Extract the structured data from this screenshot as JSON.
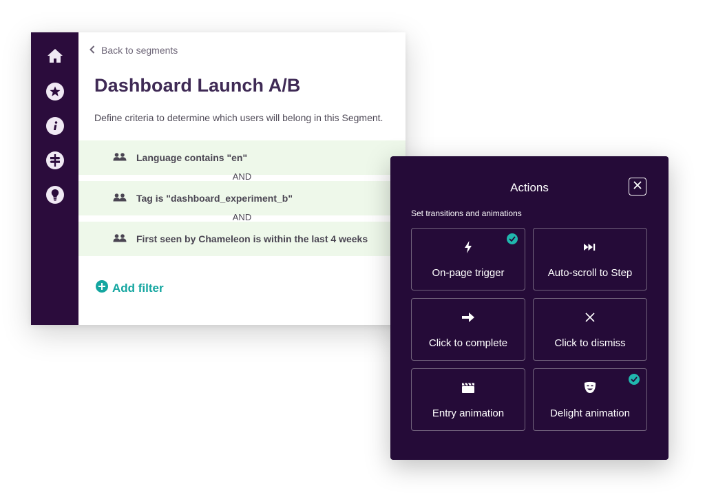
{
  "segment": {
    "back_label": "Back to segments",
    "title": "Dashboard Launch A/B",
    "description": "Define criteria to determine which users will belong in this Segment.",
    "filters": [
      {
        "label": "Language contains \"en\""
      },
      {
        "label": "Tag is \"dashboard_experiment_b\""
      },
      {
        "label": "First seen by Chameleon is within the last 4 weeks"
      }
    ],
    "connector": "AND",
    "add_filter_label": "Add filter"
  },
  "sidebar": {
    "icons": [
      "home-icon",
      "star-icon",
      "info-icon",
      "signpost-icon",
      "lightbulb-icon"
    ]
  },
  "actions": {
    "title": "Actions",
    "subtitle": "Set transitions and animations",
    "tiles": [
      {
        "label": "On-page trigger",
        "icon": "lightning-icon",
        "checked": true
      },
      {
        "label": "Auto-scroll to Step",
        "icon": "fast-forward-icon",
        "checked": false
      },
      {
        "label": "Click to complete",
        "icon": "arrow-right-icon",
        "checked": false
      },
      {
        "label": "Click to dismiss",
        "icon": "x-icon",
        "checked": false
      },
      {
        "label": "Entry animation",
        "icon": "clapperboard-icon",
        "checked": false
      },
      {
        "label": "Delight animation",
        "icon": "smile-mask-icon",
        "checked": true
      }
    ]
  },
  "colors": {
    "sidebar_bg": "#2b0c3c",
    "panel_bg": "#250b38",
    "accent_teal": "#14a6a0",
    "filter_bg": "#eef8ea",
    "title_color": "#3f2a55"
  }
}
